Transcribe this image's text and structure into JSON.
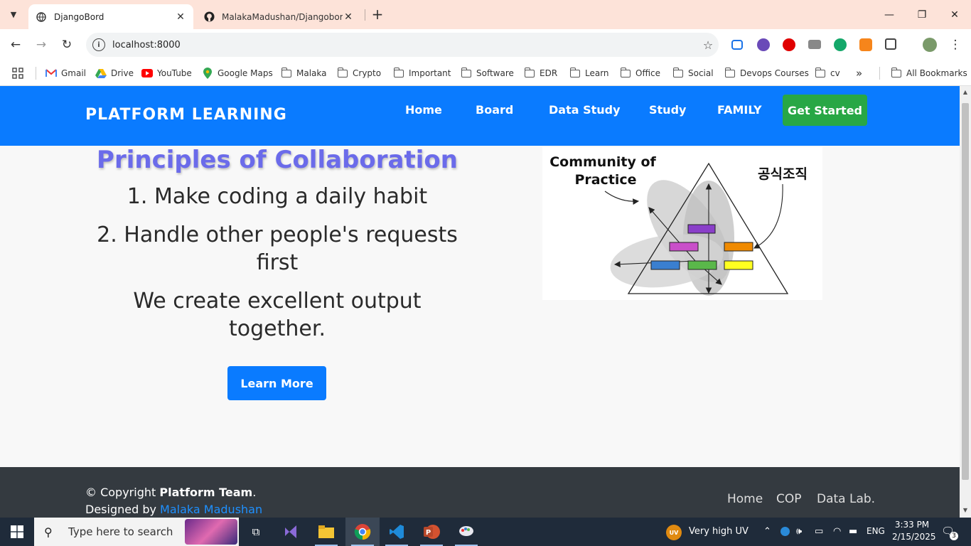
{
  "browser": {
    "tabs": [
      {
        "title": "DjangoBord",
        "active": true
      },
      {
        "title": "MalakaMadushan/Djangobord:",
        "active": false
      }
    ],
    "url": "localhost:8000",
    "bookmarks": [
      {
        "label": "Gmail",
        "icon": "gmail-icon"
      },
      {
        "label": "Drive",
        "icon": "drive-icon"
      },
      {
        "label": "YouTube",
        "icon": "youtube-icon"
      },
      {
        "label": "Google Maps",
        "icon": "maps-icon"
      },
      {
        "label": "Malaka",
        "icon": "folder-icon"
      },
      {
        "label": "Crypto",
        "icon": "folder-icon"
      },
      {
        "label": "Important",
        "icon": "folder-icon"
      },
      {
        "label": "Software",
        "icon": "folder-icon"
      },
      {
        "label": "EDR",
        "icon": "folder-icon"
      },
      {
        "label": "Learn",
        "icon": "folder-icon"
      },
      {
        "label": "Office",
        "icon": "folder-icon"
      },
      {
        "label": "Social",
        "icon": "folder-icon"
      },
      {
        "label": "Devops Courses",
        "icon": "folder-icon"
      },
      {
        "label": "cv",
        "icon": "folder-icon"
      }
    ],
    "more_bookmarks": "»",
    "all_bookmarks": "All Bookmarks"
  },
  "site": {
    "brand": "PLATFORM LEARNING",
    "nav": [
      "Home",
      "Board",
      "Data Study",
      "Study",
      "FAMILY"
    ],
    "cta": "Get Started",
    "hero": {
      "title": "Principles of Collaboration",
      "item1": "1. Make coding a daily habit",
      "item2a": "2. Handle other people's requests",
      "item2b": "first",
      "tag1": "We create excellent output",
      "tag2": "together.",
      "button": "Learn More"
    },
    "diagram": {
      "label_left_1": "Community  of",
      "label_left_2": "Practice",
      "label_right": "공식조직"
    },
    "footer": {
      "copy_prefix": "© Copyright ",
      "team": "Platform Team",
      "copy_suffix": ".",
      "designed_by": "Designed by ",
      "author": "Malaka Madushan",
      "links": [
        "Home",
        "COP",
        "Data Lab."
      ]
    }
  },
  "taskbar": {
    "search_placeholder": "Type here to search",
    "weather": "Very high UV",
    "uv_badge": "UV",
    "lang": "ENG",
    "time": "3:33 PM",
    "date": "2/15/2025",
    "notifications": "3"
  },
  "colors": {
    "nav_blue": "#0a7bff",
    "cta_green": "#28a745",
    "title_purple": "#6b6bea",
    "footer_dark": "#343a40",
    "tab_strip": "#fde3d9"
  }
}
